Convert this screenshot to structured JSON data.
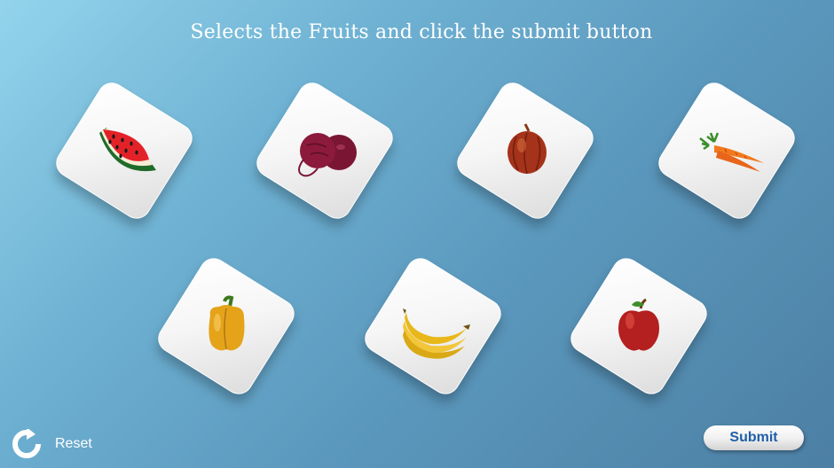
{
  "header": {
    "title": "Selects the Fruits and click the submit button"
  },
  "items": [
    {
      "label": "watermelon",
      "icon": "watermelon-icon"
    },
    {
      "label": "beetroot",
      "icon": "beetroot-icon"
    },
    {
      "label": "onion",
      "icon": "onion-icon"
    },
    {
      "label": "carrot",
      "icon": "carrot-icon"
    },
    {
      "label": "bell pepper",
      "icon": "bell-pepper-icon"
    },
    {
      "label": "banana",
      "icon": "banana-icon"
    },
    {
      "label": "apple",
      "icon": "apple-icon"
    }
  ],
  "footer": {
    "reset_label": "Reset",
    "reset_icon": "reset-arrow-icon",
    "submit_label": "Submit"
  },
  "colors": {
    "background_start": "#93d4ec",
    "background_end": "#4c7fa3",
    "submit_text": "#1f5fa8",
    "title_text": "#ffffff"
  }
}
